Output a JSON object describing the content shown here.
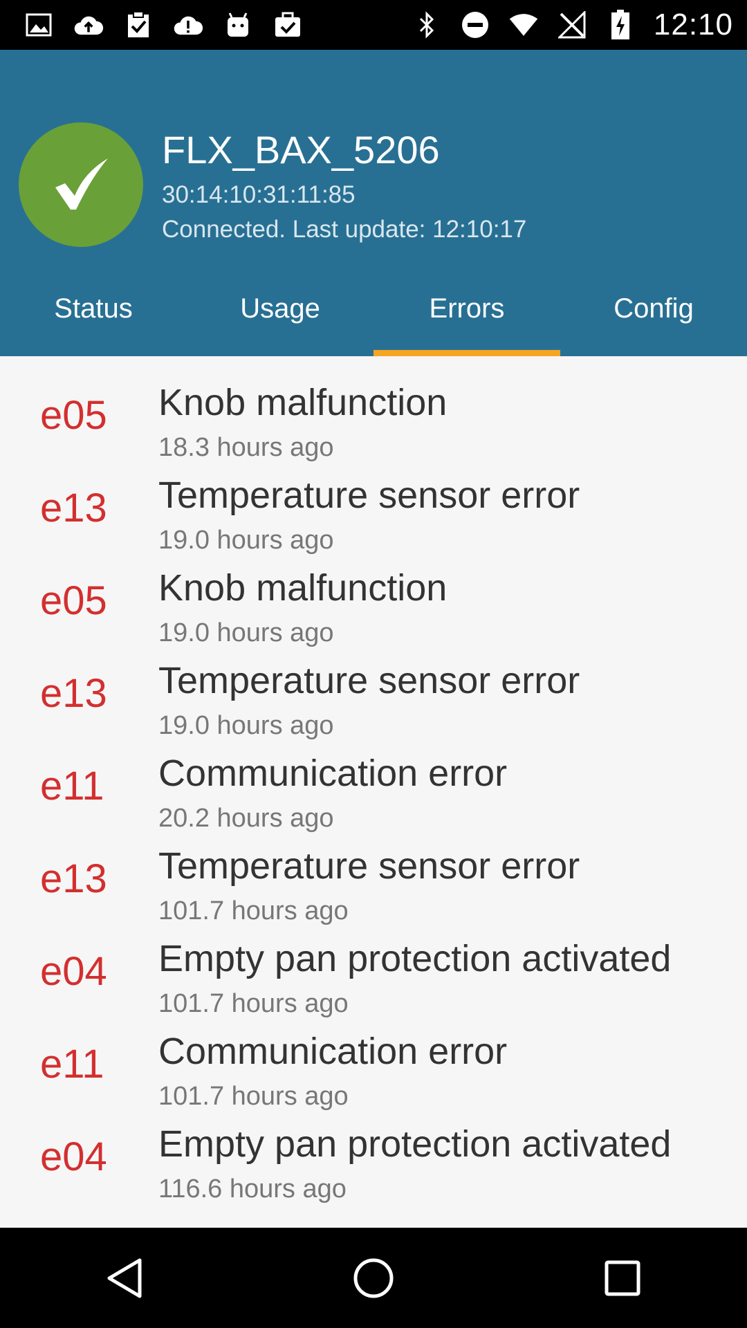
{
  "status_bar": {
    "time": "12:10",
    "left_icons": [
      "image-icon",
      "cloud-upload-icon",
      "clipboard-check-icon",
      "cloud-alert-icon",
      "android-icon",
      "briefcase-check-icon"
    ],
    "right_icons": [
      "bluetooth-icon",
      "do-not-disturb-icon",
      "wifi-icon",
      "no-signal-icon",
      "battery-charging-icon"
    ]
  },
  "header": {
    "device_name": "FLX_BAX_5206",
    "mac_address": "30:14:10:31:11:85",
    "connection_status": "Connected. Last update: 12:10:17",
    "status_icon": "check-icon",
    "colors": {
      "header_bg": "#287093",
      "status_ok": "#6aa038",
      "tab_indicator": "#f5a623",
      "error_code": "#d32f2f"
    }
  },
  "tabs": [
    {
      "label": "Status",
      "active": false
    },
    {
      "label": "Usage",
      "active": false
    },
    {
      "label": "Errors",
      "active": true
    },
    {
      "label": "Config",
      "active": false
    }
  ],
  "errors": [
    {
      "code": "e05",
      "title": "Knob malfunction",
      "time": "18.3 hours ago"
    },
    {
      "code": "e13",
      "title": "Temperature sensor error",
      "time": "19.0 hours ago"
    },
    {
      "code": "e05",
      "title": "Knob malfunction",
      "time": "19.0 hours ago"
    },
    {
      "code": "e13",
      "title": "Temperature sensor error",
      "time": "19.0 hours ago"
    },
    {
      "code": "e11",
      "title": "Communication error",
      "time": "20.2 hours ago"
    },
    {
      "code": "e13",
      "title": "Temperature sensor error",
      "time": "101.7 hours ago"
    },
    {
      "code": "e04",
      "title": "Empty pan protection activated",
      "time": "101.7 hours ago"
    },
    {
      "code": "e11",
      "title": "Communication error",
      "time": "101.7 hours ago"
    },
    {
      "code": "e04",
      "title": "Empty pan protection activated",
      "time": "116.6 hours ago"
    }
  ],
  "nav_bar": [
    "back-icon",
    "home-icon",
    "recents-icon"
  ]
}
